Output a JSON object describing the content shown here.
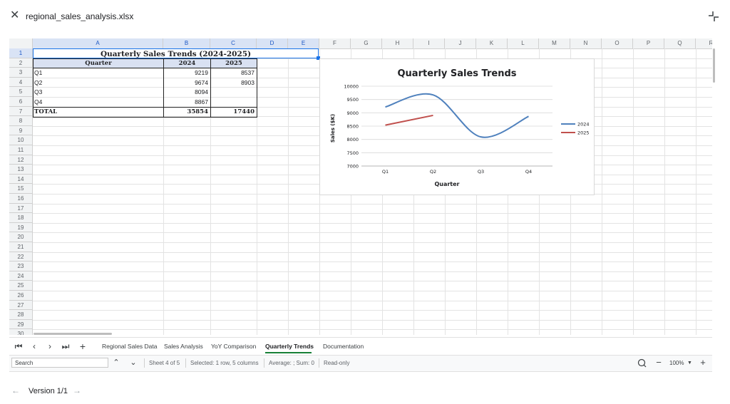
{
  "window": {
    "file_name": "regional_sales_analysis.xlsx"
  },
  "columns": [
    "A",
    "B",
    "C",
    "D",
    "E",
    "F",
    "G",
    "H",
    "I",
    "J",
    "K",
    "L",
    "M",
    "N",
    "O",
    "P",
    "Q",
    "R"
  ],
  "rows": [
    "1",
    "2",
    "3",
    "4",
    "5",
    "6",
    "7",
    "8",
    "9",
    "10",
    "11",
    "12",
    "13",
    "14",
    "15",
    "16",
    "17",
    "18",
    "19",
    "20",
    "21",
    "22",
    "23",
    "24",
    "25",
    "26",
    "27",
    "28",
    "29",
    "30"
  ],
  "sheet": {
    "title": "Quarterly Sales Trends (2024-2025)",
    "headers": [
      "Quarter",
      "2024",
      "2025"
    ],
    "data": [
      {
        "quarter": "Q1",
        "y2024": "9219",
        "y2025": "8537"
      },
      {
        "quarter": "Q2",
        "y2024": "9674",
        "y2025": "8903"
      },
      {
        "quarter": "Q3",
        "y2024": "8094",
        "y2025": ""
      },
      {
        "quarter": "Q4",
        "y2024": "8867",
        "y2025": ""
      }
    ],
    "total": {
      "label": "TOTAL",
      "y2024": "35854",
      "y2025": "17440"
    }
  },
  "chart_data": {
    "type": "line",
    "title": "Quarterly Sales Trends",
    "xlabel": "Quarter",
    "ylabel": "Sales ($K)",
    "categories": [
      "Q1",
      "Q2",
      "Q3",
      "Q4"
    ],
    "yticks": [
      "7000",
      "7500",
      "8000",
      "8500",
      "9000",
      "9500",
      "10000"
    ],
    "ylim": [
      7000,
      10000
    ],
    "series": [
      {
        "name": "2024",
        "values": [
          9219,
          9674,
          8094,
          8867
        ],
        "color": "#4f81bd",
        "smooth": true
      },
      {
        "name": "2025",
        "values": [
          8537,
          8903
        ],
        "color": "#c0504d",
        "smooth": false
      }
    ],
    "legend": "right",
    "grid": true
  },
  "tabs": {
    "items": [
      "Regional Sales Data",
      "Sales Analysis",
      "YoY Comparison",
      "Quarterly Trends",
      "Documentation"
    ],
    "active": "Quarterly Trends"
  },
  "status": {
    "search_placeholder": "Search",
    "sheet_info": "Sheet 4 of 5",
    "selection": "Selected: 1 row, 5 columns",
    "stats": "Average: ; Sum: 0",
    "mode": "Read-only",
    "zoom": "100%"
  },
  "footer": {
    "version": "Version 1/1"
  },
  "colors": {
    "accent": "#1a73e8",
    "tab_underline": "#188038",
    "header_fill": "#d9e1f2"
  }
}
